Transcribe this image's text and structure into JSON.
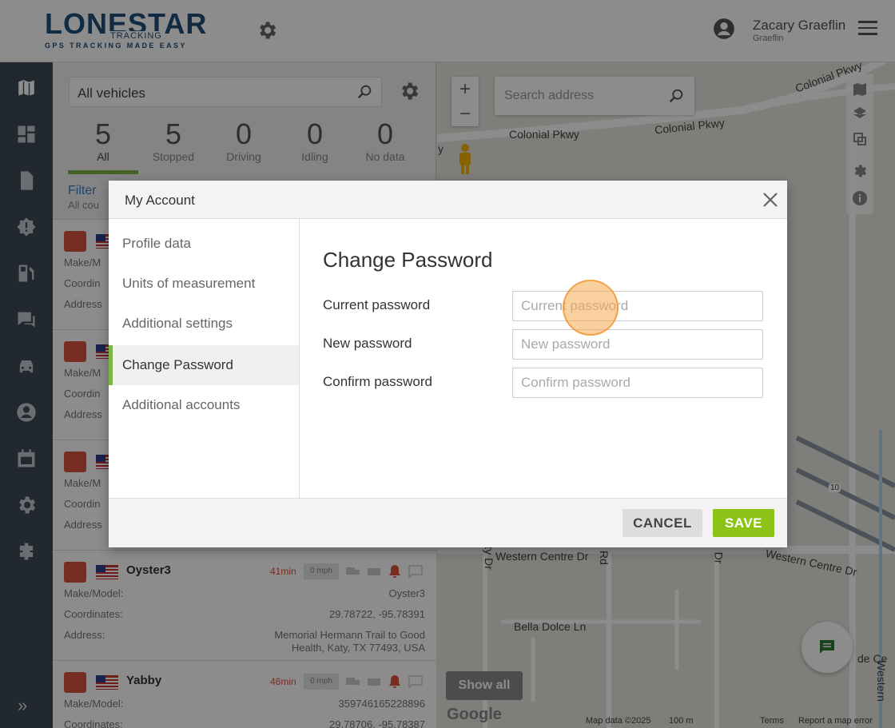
{
  "header": {
    "logo_main": "LONESTAR",
    "logo_sub": "TRACKING",
    "logo_tag": "GPS TRACKING MADE EASY",
    "user_name": "Zacary Graeflin",
    "user_sub": "Graeflin"
  },
  "vehicles": {
    "search_value": "All vehicles",
    "stats": [
      {
        "count": "5",
        "label": "All"
      },
      {
        "count": "5",
        "label": "Stopped"
      },
      {
        "count": "0",
        "label": "Driving"
      },
      {
        "count": "0",
        "label": "Idling"
      },
      {
        "count": "0",
        "label": "No data"
      }
    ],
    "filter_label": "Filter",
    "filter_sub": "All cou",
    "labels": {
      "make": "Make/Model:",
      "coords": "Coordinates:",
      "address": "Address:"
    },
    "partial_labels": {
      "make": "Make/M",
      "coords": "Coordin",
      "address": "Address"
    },
    "rows": [
      {
        "name": "Oyster3",
        "time": "41min",
        "speed": "0 mph",
        "make": "Oyster3",
        "coords": "29.78722, -95.78391",
        "address_1": "Memorial Hermann Trail to Good",
        "address_2": "Health, Katy, TX 77493, USA"
      },
      {
        "name": "Yabby",
        "time": "46min",
        "speed": "0 mph",
        "make": "359746165228896",
        "coords": "29.78706, -95.78387"
      }
    ]
  },
  "map": {
    "search_placeholder": "Search address",
    "roads": [
      "Colonial Pkwy",
      "Colonial Pkwy",
      "Colonial Pkwy",
      "Western Centre Dr",
      "Western Centre Dr",
      "Bella Dolce Ln",
      "Rd",
      "Dr",
      "ty Dr",
      "y",
      "10",
      "de Ce",
      "Western"
    ],
    "show_all": "Show all",
    "google": "Google",
    "footer": {
      "data": "Map data ©2025",
      "scale": "100 m",
      "terms": "Terms",
      "report": "Report a map error"
    }
  },
  "modal": {
    "title": "My Account",
    "nav": [
      "Profile data",
      "Units of measurement",
      "Additional settings",
      "Change Password",
      "Additional accounts"
    ],
    "heading": "Change Password",
    "fields": [
      {
        "label": "Current password",
        "placeholder": "Current password"
      },
      {
        "label": "New password",
        "placeholder": "New password"
      },
      {
        "label": "Confirm password",
        "placeholder": "Confirm password"
      }
    ],
    "cancel": "CANCEL",
    "save": "SAVE"
  },
  "colors": {
    "accent": "#7cb342",
    "save": "#8bc417",
    "alert": "#d9533c",
    "nav": "#3c4a56"
  }
}
